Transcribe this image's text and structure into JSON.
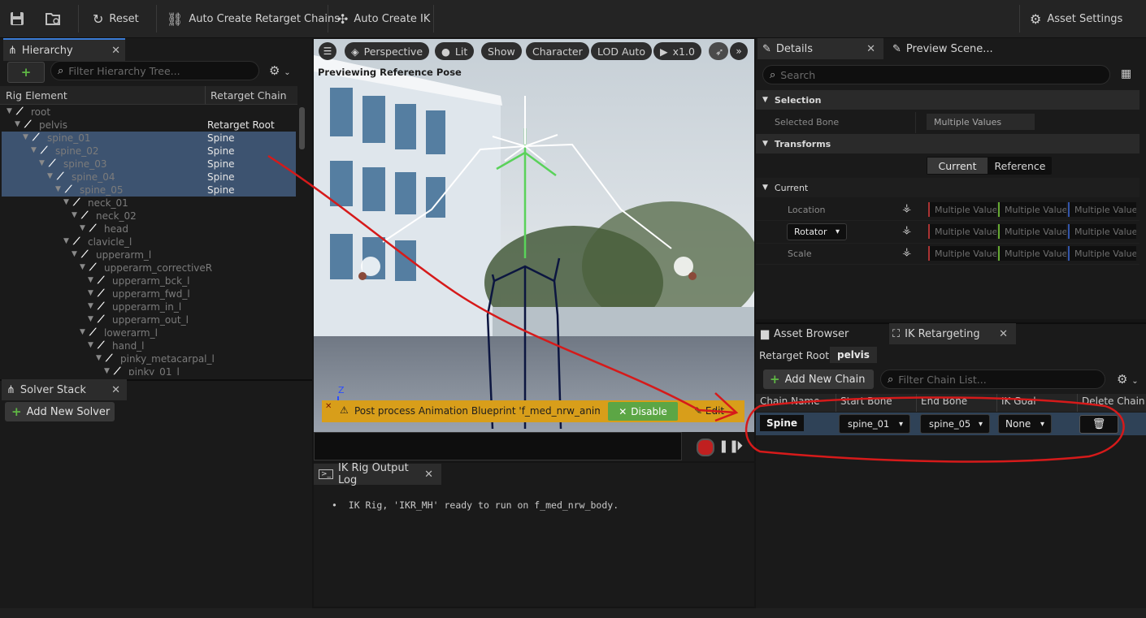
{
  "toolbar": {
    "reset": "Reset",
    "auto_chains": "Auto Create Retarget Chains",
    "auto_ik": "Auto Create IK",
    "asset_settings": "Asset Settings"
  },
  "hierarchy": {
    "tab": "Hierarchy",
    "search_placeholder": "Filter Hierarchy Tree...",
    "col_element": "Rig Element",
    "col_chain": "Retarget Chain",
    "rows": [
      {
        "name": "root",
        "chain": ""
      },
      {
        "name": "pelvis",
        "chain": "Retarget Root"
      },
      {
        "name": "spine_01",
        "chain": "Spine"
      },
      {
        "name": "spine_02",
        "chain": "Spine"
      },
      {
        "name": "spine_03",
        "chain": "Spine"
      },
      {
        "name": "spine_04",
        "chain": "Spine"
      },
      {
        "name": "spine_05",
        "chain": "Spine"
      },
      {
        "name": "neck_01",
        "chain": ""
      },
      {
        "name": "neck_02",
        "chain": ""
      },
      {
        "name": "head",
        "chain": ""
      },
      {
        "name": "clavicle_l",
        "chain": ""
      },
      {
        "name": "upperarm_l",
        "chain": ""
      },
      {
        "name": "upperarm_correctiveR",
        "chain": ""
      },
      {
        "name": "upperarm_bck_l",
        "chain": ""
      },
      {
        "name": "upperarm_fwd_l",
        "chain": ""
      },
      {
        "name": "upperarm_in_l",
        "chain": ""
      },
      {
        "name": "upperarm_out_l",
        "chain": ""
      },
      {
        "name": "lowerarm_l",
        "chain": ""
      },
      {
        "name": "hand_l",
        "chain": ""
      },
      {
        "name": "pinky_metacarpal_l",
        "chain": ""
      },
      {
        "name": "pinky_01_l",
        "chain": ""
      }
    ]
  },
  "solver": {
    "tab": "Solver Stack",
    "add": "Add New Solver"
  },
  "viewport": {
    "perspective": "Perspective",
    "lit": "Lit",
    "show": "Show",
    "character": "Character",
    "lod": "LOD Auto",
    "speed": "x1.0",
    "status": "Previewing Reference Pose",
    "warning": "Post process Animation Blueprint 'f_med_nrw_animb",
    "disable": "Disable",
    "edit": "Edit",
    "axis": "Z"
  },
  "log": {
    "tab": "IK Rig Output Log",
    "line": "IK Rig, 'IKR_MH' ready to run on f_med_nrw_body."
  },
  "details": {
    "tab": "Details",
    "tab2": "Preview Scene...",
    "search_placeholder": "Search",
    "selection": "Selection",
    "selected_bone_label": "Selected Bone",
    "selected_bone_value": "Multiple Values",
    "transforms": "Transforms",
    "current_btn": "Current",
    "reference_btn": "Reference",
    "current": "Current",
    "location": "Location",
    "rotator": "Rotator",
    "scale": "Scale",
    "mv": "Multiple Values"
  },
  "retarget": {
    "tab1": "Asset Browser",
    "tab2": "IK Retargeting",
    "root_label": "Retarget Root:",
    "root_value": "pelvis",
    "add_chain": "Add New Chain",
    "filter_placeholder": "Filter Chain List...",
    "cols": [
      "Chain Name",
      "Start Bone",
      "End Bone",
      "IK Goal",
      "Delete Chain"
    ],
    "chain": {
      "name": "Spine",
      "start": "spine_01",
      "end": "spine_05",
      "goal": "None"
    }
  }
}
